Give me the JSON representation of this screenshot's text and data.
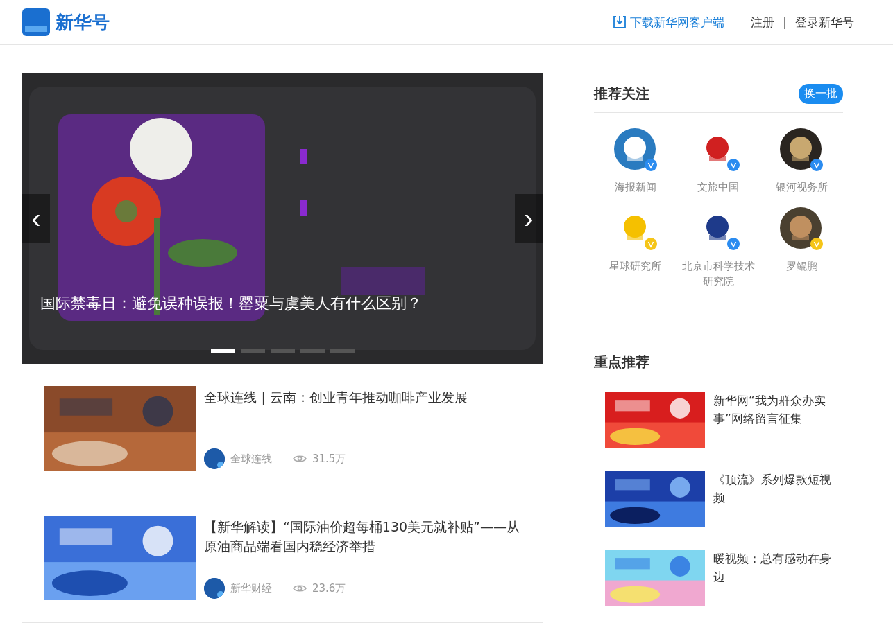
{
  "header": {
    "logo_text": "新华号",
    "download_link": "下载新华网客户端",
    "register": "注册",
    "separator": "|",
    "login": "登录新华号"
  },
  "carousel": {
    "caption": "国际禁毒日：避免误种误报！罂粟与虞美人有什么区别？",
    "prev": "‹",
    "next": "›",
    "dots": [
      {
        "selected": true
      },
      {
        "selected": false
      },
      {
        "selected": false
      },
      {
        "selected": false
      },
      {
        "selected": false
      }
    ]
  },
  "articles": [
    {
      "title": "全球连线｜云南：创业青年推动咖啡产业发展",
      "author": "全球连线",
      "views": "31.5万"
    },
    {
      "title": "【新华解读】“国际油价超每桶130美元就补贴”——从原油商品端看国内稳经济举措",
      "author": "新华财经",
      "views": "23.6万"
    }
  ],
  "recommend": {
    "title": "推荐关注",
    "refresh_button": "换一批",
    "accounts": [
      {
        "name": "海报新闻",
        "color": "#2b8cf0"
      },
      {
        "name": "文旅中国",
        "color": "#2b8cf0"
      },
      {
        "name": "银河视务所",
        "color": "#2b8cf0"
      },
      {
        "name": "星球研究所",
        "color": "#f5c518"
      },
      {
        "name": "北京市科学技术研究院",
        "color": "#2b8cf0"
      },
      {
        "name": "罗鲲鹏",
        "color": "#f5c518"
      }
    ]
  },
  "featured": {
    "title": "重点推荐",
    "items": [
      {
        "title": "新华网“我为群众办实事”网络留言征集"
      },
      {
        "title": "《顶流》系列爆款短视频"
      },
      {
        "title": "暖视频：总有感动在身边"
      }
    ]
  }
}
